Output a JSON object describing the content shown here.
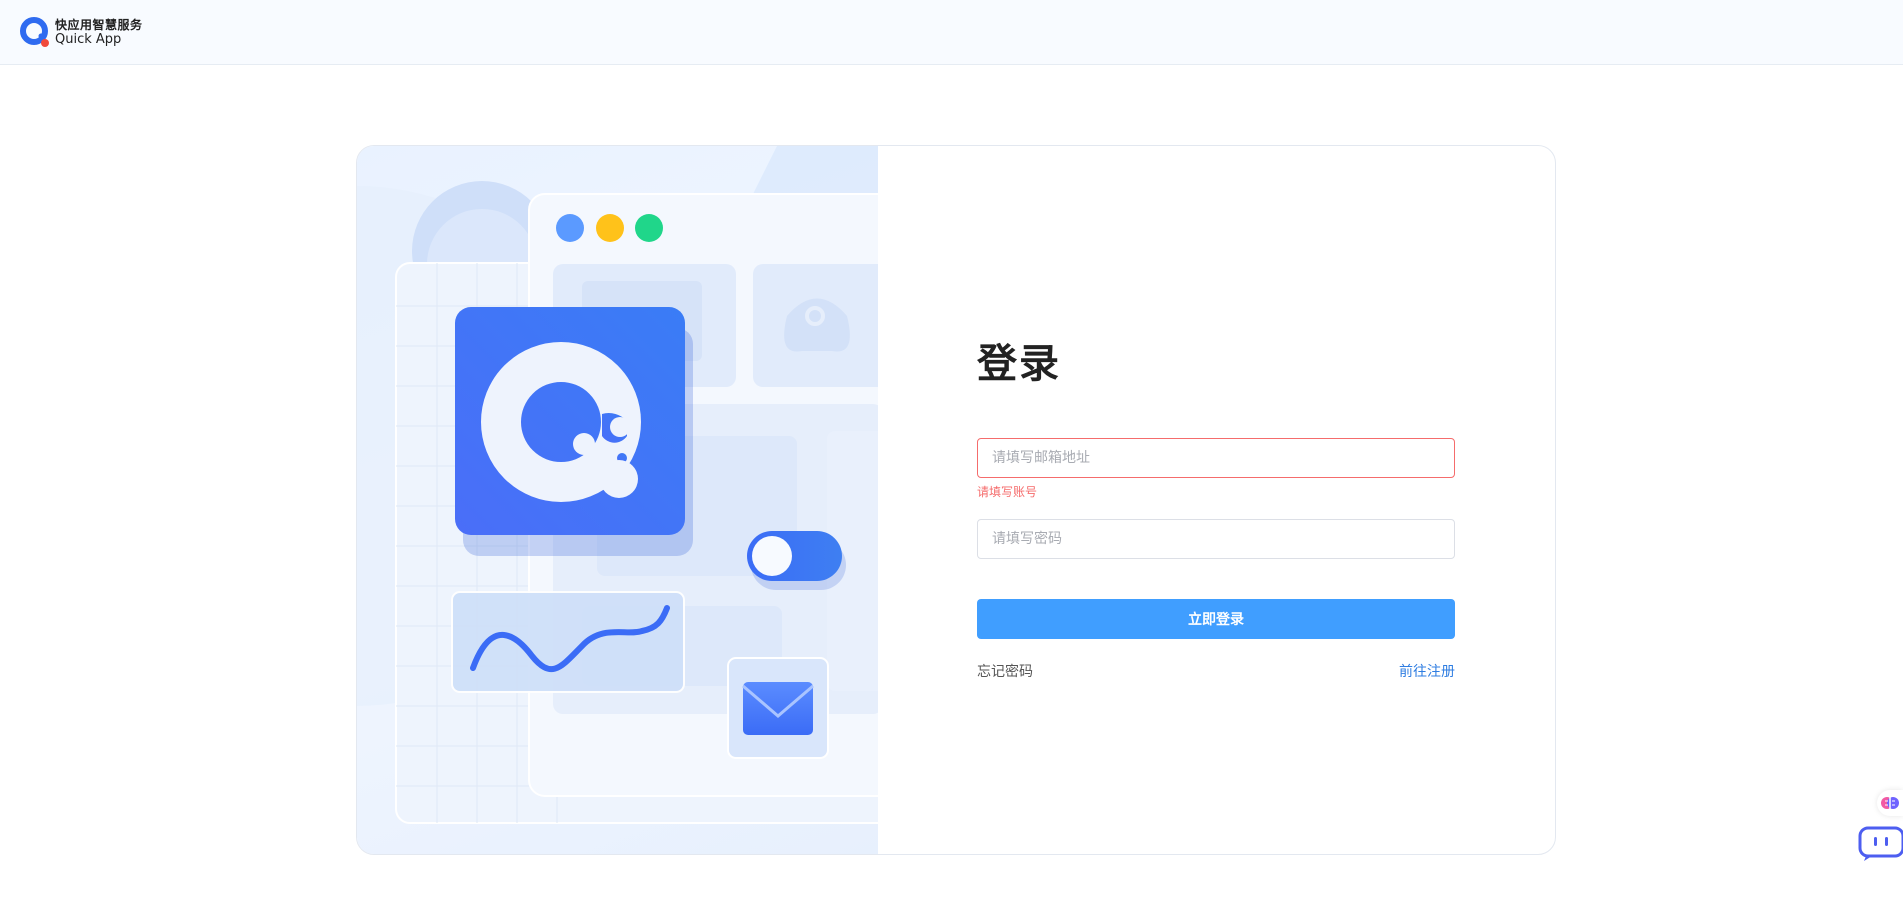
{
  "brand": {
    "name_cn": "快应用智慧服务",
    "name_en": "Quick App",
    "logo_icon": "quick-app-logo-icon"
  },
  "login": {
    "title": "登录",
    "email_placeholder": "请填写邮箱地址",
    "email_value": "",
    "email_error": "请填写账号",
    "password_placeholder": "请填写密码",
    "password_value": "",
    "submit_label": "立即登录",
    "forgot_label": "忘记密码",
    "register_label": "前往注册"
  },
  "colors": {
    "primary": "#409eff",
    "error": "#f56c6c",
    "link": "#2f7de1",
    "brand_blue": "#3b6cf6"
  },
  "floating": {
    "brain_icon": "brain-icon",
    "chat_icon": "chat-bot-icon"
  }
}
